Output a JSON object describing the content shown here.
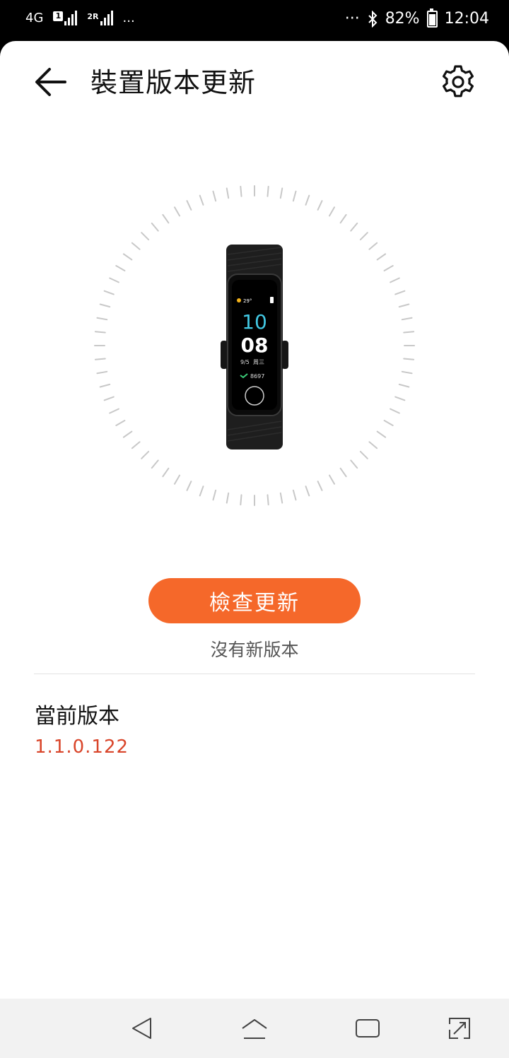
{
  "status_bar": {
    "network": "4G",
    "sim1_badge": "1",
    "sim2_badge": "2R",
    "left_more": "...",
    "right_more": "···",
    "battery": "82%",
    "time": "12:04"
  },
  "header": {
    "title": "裝置版本更新",
    "back_icon": "arrow-left-icon",
    "settings_icon": "gear-icon"
  },
  "device_screen": {
    "weather": "29°",
    "hour": "10",
    "minute": "08",
    "date": "9/5",
    "weekday": "周三",
    "steps": "8697"
  },
  "actions": {
    "check_update_label": "檢查更新"
  },
  "status": {
    "message": "沒有新版本"
  },
  "current_version": {
    "label": "當前版本",
    "value": "1.1.0.122"
  },
  "colors": {
    "accent": "#f5682a",
    "version": "#d9452a"
  },
  "navbar": {
    "icons": [
      "back-triangle-icon",
      "home-icon",
      "recents-icon",
      "screen-toggle-icon"
    ]
  }
}
